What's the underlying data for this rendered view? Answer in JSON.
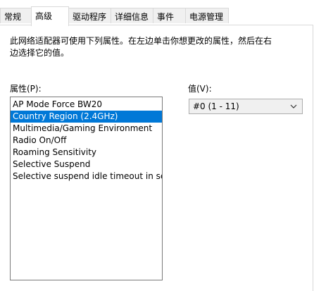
{
  "tabs": [
    {
      "label": "常规"
    },
    {
      "label": "高级"
    },
    {
      "label": "驱动程序"
    },
    {
      "label": "详细信息"
    },
    {
      "label": "事件"
    },
    {
      "label": "电源管理"
    }
  ],
  "active_tab": "高级",
  "description": "此网络适配器可使用下列属性。在左边单击你想更改的属性，然后在右边选择它的值。",
  "property_label": "属性(P):",
  "value_label": "值(V):",
  "properties": [
    {
      "label": "AP Mode Force BW20"
    },
    {
      "label": "Country Region (2.4GHz)"
    },
    {
      "label": "Multimedia/Gaming Environment"
    },
    {
      "label": "Radio On/Off"
    },
    {
      "label": "Roaming Sensitivity"
    },
    {
      "label": "Selective Suspend"
    },
    {
      "label": "Selective suspend idle timeout in ser"
    }
  ],
  "selected_property": "Country Region (2.4GHz)",
  "value_select": {
    "value": "#0 (1 - 11)"
  },
  "colors": {
    "selection": "#0078d7",
    "border": "#7a7a7a"
  },
  "icons": {
    "dropdown": "chevron-down-icon"
  }
}
